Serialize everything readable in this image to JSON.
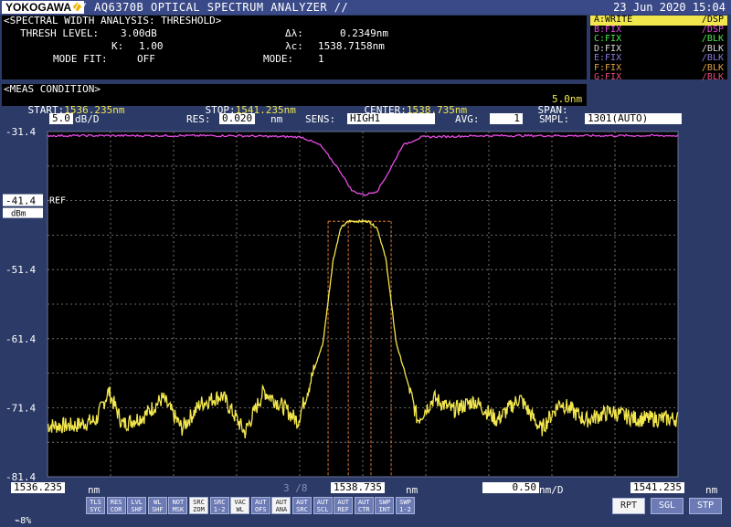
{
  "header": {
    "brand": "YOKOGAWA",
    "title": "// AQ6370B OPTICAL SPECTRUM ANALYZER //",
    "date": "23 Jun 2020 15:04"
  },
  "analysis": {
    "heading": "<SPECTRAL WIDTH ANALYSIS: THRESHOLD>",
    "thresh_label": "THRESH LEVEL:",
    "thresh_value": "3.00dB",
    "k_label": "K:",
    "k_value": "1.00",
    "mode_fit_label": "MODE FIT:",
    "mode_fit_value": "OFF",
    "dl_label": "Δλ:",
    "dl_value": "0.2349nm",
    "lc_label": "λc:",
    "lc_value": "1538.7158nm",
    "mode_label": "MODE:",
    "mode_value": "1"
  },
  "traces": [
    {
      "left": "A:WRITE",
      "right": "/DSP",
      "color": "#f2e64d"
    },
    {
      "left": "B:FIX",
      "right": "/DSP",
      "color": "#e64de6"
    },
    {
      "left": "C:FIX",
      "right": "/BLK",
      "color": "#4de64d"
    },
    {
      "left": "D:FIX",
      "right": "/BLK",
      "color": "#d8d8d8"
    },
    {
      "left": "E:FIX",
      "right": "/BLK",
      "color": "#8a7ae0"
    },
    {
      "left": "F:FIX",
      "right": "/BLK",
      "color": "#e0a040"
    },
    {
      "left": "G:FIX",
      "right": "/BLK",
      "color": "#e64d80"
    }
  ],
  "meas": {
    "heading": "<MEAS CONDITION>",
    "start_label": "START:",
    "start_value": "1536.235nm",
    "stop_label": "STOP:",
    "stop_value": "1541.235nm",
    "center_label": "CENTER:",
    "center_value": "1538.735nm",
    "span_label": "SPAN:",
    "span_value": "5.0nm"
  },
  "settings": {
    "scale_value": "5.0",
    "scale_unit": "dB/D",
    "res_label": "RES:",
    "res_value": "0.020",
    "res_unit": "nm",
    "sens_label": "SENS:",
    "sens_value": "HIGH1",
    "avg_label": "AVG:",
    "avg_value": "1",
    "smpl_label": "SMPL:",
    "smpl_value": "1301(AUTO)"
  },
  "ref": {
    "value": "-41.4",
    "label": "REF",
    "unit": "dBm"
  },
  "chart_data": {
    "type": "line",
    "xlim": [
      1536.235,
      1541.235
    ],
    "ylim": [
      -81.4,
      -31.4
    ],
    "y_ticks": [
      "-31.4",
      "-41.4",
      "-51.4",
      "-61.4",
      "-71.4",
      "-81.4"
    ],
    "grid": true,
    "series": [
      {
        "color": "#f2e64d",
        "x": [
          1536.235,
          1536.45,
          1536.62,
          1536.72,
          1536.83,
          1537.0,
          1537.15,
          1537.3,
          1537.45,
          1537.62,
          1537.8,
          1537.95,
          1538.1,
          1538.22,
          1538.33,
          1538.42,
          1538.5,
          1538.56,
          1538.62,
          1538.7,
          1538.78,
          1538.85,
          1538.92,
          1539.0,
          1539.08,
          1539.17,
          1539.3,
          1539.45,
          1539.62,
          1539.8,
          1539.98,
          1540.15,
          1540.3,
          1540.5,
          1540.7,
          1540.9,
          1541.235
        ],
        "y": [
          -74.0,
          -74.0,
          -73.2,
          -69.0,
          -73.8,
          -72.6,
          -70.0,
          -74.4,
          -70.8,
          -69.6,
          -75.0,
          -69.0,
          -71.2,
          -73.4,
          -67.0,
          -62.0,
          -50.0,
          -45.4,
          -44.4,
          -44.4,
          -44.4,
          -45.4,
          -50.0,
          -62.0,
          -67.0,
          -73.2,
          -70.0,
          -71.8,
          -70.4,
          -73.2,
          -70.0,
          -74.6,
          -70.6,
          -73.2,
          -72.0,
          -73.0,
          -73.0
        ]
      },
      {
        "color": "#e64de6",
        "x": [
          1536.235,
          1537.0,
          1537.7,
          1538.25,
          1538.4,
          1538.55,
          1538.65,
          1538.75,
          1538.85,
          1538.95,
          1539.05,
          1539.2,
          1539.7,
          1540.5,
          1541.235
        ],
        "y": [
          -32.0,
          -32.0,
          -32.0,
          -32.2,
          -33.4,
          -37.0,
          -40.0,
          -40.6,
          -40.0,
          -37.0,
          -33.4,
          -32.2,
          -32.0,
          -32.0,
          -32.0
        ]
      }
    ]
  },
  "bottom": {
    "start_value": "1536.235",
    "start_unit": "nm",
    "page": "3 /8",
    "center_value": "1538.735",
    "center_unit": "nm",
    "div_value": "0.50",
    "div_unit": "nm/D",
    "stop_value": "1541.235",
    "stop_unit": "nm",
    "battery": "8%"
  },
  "softkeys": [
    {
      "l1": "TLS",
      "l2": "SYC",
      "white": false
    },
    {
      "l1": "RES",
      "l2": "COR",
      "white": false
    },
    {
      "l1": "LVL",
      "l2": "SHF",
      "white": false
    },
    {
      "l1": "WL",
      "l2": "SHF",
      "white": false
    },
    {
      "l1": "NOT",
      "l2": "MSK",
      "white": false
    },
    {
      "l1": "SRC",
      "l2": "ZOM",
      "white": true
    },
    {
      "l1": "SRC",
      "l2": "1-2",
      "white": false
    },
    {
      "l1": "VAC",
      "l2": "WL",
      "white": true
    },
    {
      "l1": "AUT",
      "l2": "OFS",
      "white": false
    },
    {
      "l1": "AUT",
      "l2": "ANA",
      "white": true
    },
    {
      "l1": "AUT",
      "l2": "SRC",
      "white": false
    },
    {
      "l1": "AUT",
      "l2": "SCL",
      "white": false
    },
    {
      "l1": "AUT",
      "l2": "REF",
      "white": false
    },
    {
      "l1": "AUT",
      "l2": "CTR",
      "white": false
    },
    {
      "l1": "SWP",
      "l2": "INT",
      "white": false
    },
    {
      "l1": "SWP",
      "l2": "1-2",
      "white": false
    }
  ],
  "bigkeys": [
    {
      "label": "RPT",
      "white": true
    },
    {
      "label": "SGL",
      "white": false
    },
    {
      "label": "STP",
      "white": false
    }
  ]
}
